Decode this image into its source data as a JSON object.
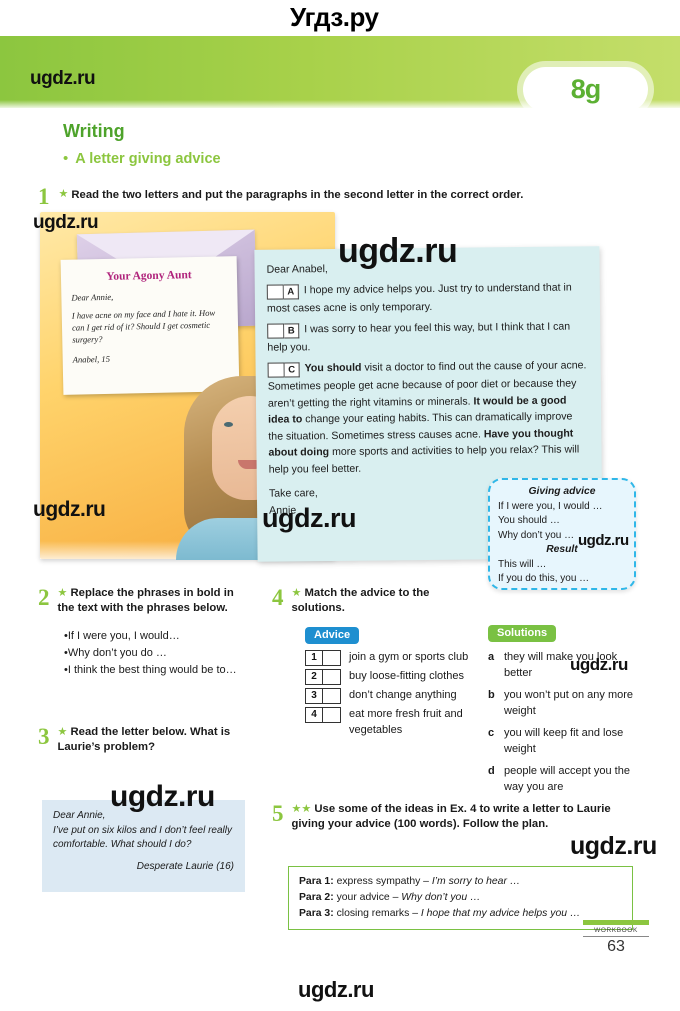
{
  "watermarks": {
    "top": "Угдз.ру",
    "bottom": "ugdz.ru",
    "site": "ugdz.ru"
  },
  "header": {
    "unit_tab": "8g",
    "section_title": "Writing",
    "subtitle": "A letter giving advice",
    "bullet": "•"
  },
  "colors": {
    "green_dark": "#4ea32b",
    "green_light": "#8cc63f",
    "blue_tag": "#1e8fd0",
    "green_tag": "#7ac143",
    "cyan_border": "#2fb7e8",
    "magenta": "#b0247c"
  },
  "exercises": {
    "ex1": {
      "number": "1",
      "stars": "★",
      "instruction": "Read the two letters and put the paragraphs in the second letter in the correct order."
    },
    "ex2": {
      "number": "2",
      "stars": "★",
      "instruction": "Replace the phrases in bold in the text with the phrases below.",
      "items": [
        "If I were you, I would…",
        "Why don’t you do …",
        "I think the best thing would be to…"
      ]
    },
    "ex3": {
      "number": "3",
      "stars": "★",
      "instruction": "Read the letter below. What is Laurie’s problem?"
    },
    "ex4": {
      "number": "4",
      "stars": "★",
      "instruction": "Match the advice to the solutions.",
      "advice_label": "Advice",
      "solutions_label": "Solutions",
      "advice": [
        {
          "num": "1",
          "text": "join a gym or sports club"
        },
        {
          "num": "2",
          "text": "buy loose-fitting clothes"
        },
        {
          "num": "3",
          "text": "don’t change anything"
        },
        {
          "num": "4",
          "text": "eat more fresh fruit and vegetables"
        }
      ],
      "solutions": [
        {
          "key": "a",
          "text": "they will make you look better"
        },
        {
          "key": "b",
          "text": "you won’t put on any more weight"
        },
        {
          "key": "c",
          "text": "you will keep fit and lose weight"
        },
        {
          "key": "d",
          "text": "people will accept you the way you are"
        }
      ]
    },
    "ex5": {
      "number": "5",
      "stars": "★★",
      "instruction": "Use some of the ideas in Ex. 4 to write a letter to Laurie giving your advice (100 words). Follow the plan.",
      "plan": [
        {
          "label": "Para 1:",
          "text": "express sympathy – ",
          "italic": "I’m sorry to hear …"
        },
        {
          "label": "Para 2:",
          "text": "your advice – ",
          "italic": "Why don’t you …"
        },
        {
          "label": "Para 3:",
          "text": "closing remarks – ",
          "italic": "I hope that my advice helps you …"
        }
      ]
    }
  },
  "agony_note": {
    "title": "Your Agony Aunt",
    "greeting": "Dear Annie,",
    "body": "I have acne on my face and I hate it. How can I get rid of it? Should I get cosmetic surgery?",
    "signature": "Anabel, 15"
  },
  "reply_letter": {
    "greeting": "Dear Anabel,",
    "paragraphs": [
      {
        "letter": "A",
        "lead": "",
        "text": "I hope my advice helps you. Just try to understand that in most cases acne is only temporary."
      },
      {
        "letter": "B",
        "lead": "",
        "text": "I was sorry to hear you feel this way, but I think that I can help you."
      },
      {
        "letter": "C",
        "lead": "You should",
        "text": " visit a doctor to find out the cause of your acne. Sometimes people get acne because of poor diet or because they aren’t getting the right vitamins or minerals. ",
        "bold2": "It would be a good idea to",
        "text2": " change your eating habits. This can dramatically improve the situation. Sometimes stress causes acne. ",
        "bold3": "Have you thought about doing",
        "text3": " more sports and activities to help you relax? This will help you feel better."
      }
    ],
    "signoff": "Take care,",
    "signature": "Annie"
  },
  "advice_box": {
    "heading1": "Giving advice",
    "lines1": [
      "If I were you, I would …",
      "You should …",
      "Why don’t you …"
    ],
    "heading2": "Result",
    "lines2": [
      "This will …",
      "If you do this, you …"
    ]
  },
  "laurie_note": {
    "greeting": "Dear Annie,",
    "body": "I’ve put on six kilos and I don’t feel really comfortable. What should I do?",
    "signature": "Desperate Laurie (16)"
  },
  "footer": {
    "label": "WORKBOOK",
    "page": "63"
  }
}
